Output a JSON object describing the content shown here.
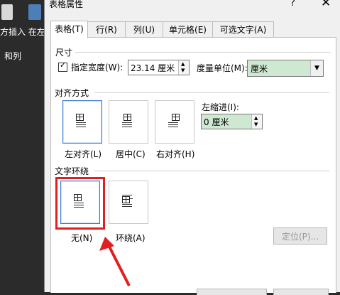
{
  "background": {
    "text1": "方插入 在左",
    "text2": "和列"
  },
  "dialog": {
    "title": "表格属性",
    "help": "?",
    "close": "✕",
    "tabs": [
      "表格(T)",
      "行(R)",
      "列(U)",
      "单元格(E)",
      "可选文字(A)"
    ],
    "size": {
      "section": "尺寸",
      "width_checkbox_label": "指定宽度(W):",
      "width_checked": true,
      "width_value": "23.14 厘米",
      "unit_label": "度量单位(M):",
      "unit_value": "厘米"
    },
    "alignment": {
      "section": "对齐方式",
      "options": [
        "左对齐(L)",
        "居中(C)",
        "右对齐(H)"
      ],
      "selected": "左对齐(L)",
      "indent_label": "左缩进(I):",
      "indent_value": "0 厘米"
    },
    "wrap": {
      "section": "文字环绕",
      "options": [
        "无(N)",
        "环绕(A)"
      ],
      "selected": "无(N)",
      "position_button": "定位(P)..."
    }
  },
  "colors": {
    "highlight_red": "#e02020",
    "input_green": "#cfe8d2",
    "selection_blue": "#3a7bd5"
  }
}
